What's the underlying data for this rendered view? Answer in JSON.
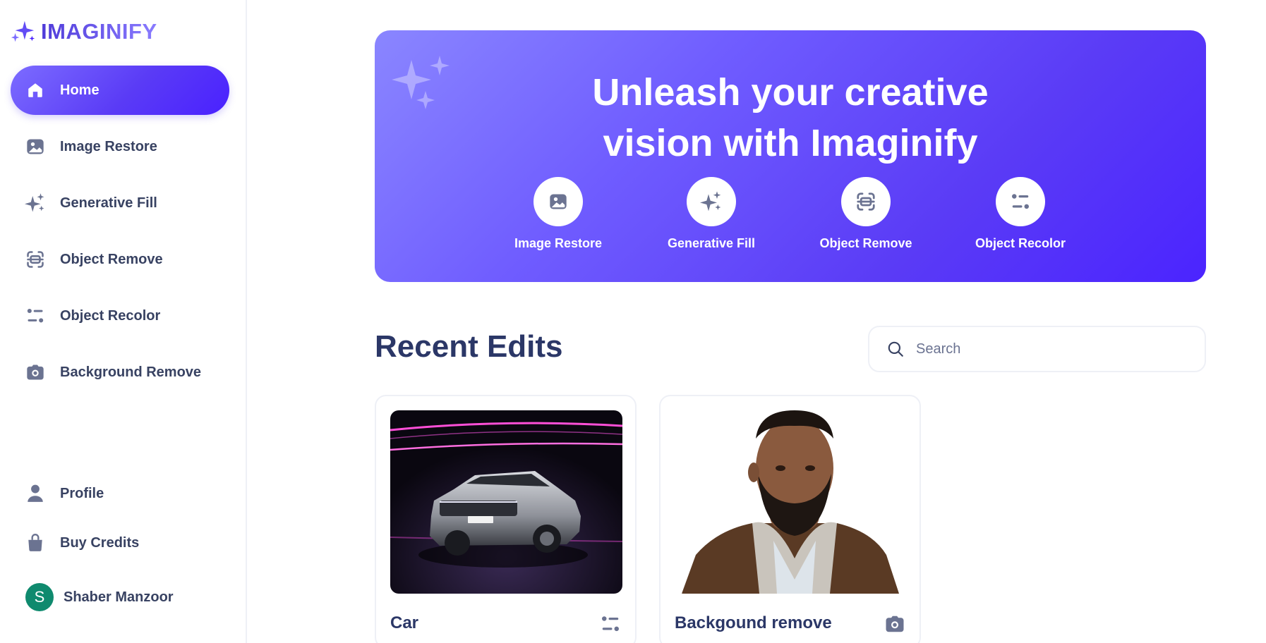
{
  "brand": {
    "name": "IMAGINIFY"
  },
  "sidebar": {
    "items": [
      {
        "label": "Home",
        "icon": "home-icon",
        "active": true
      },
      {
        "label": "Image Restore",
        "icon": "image-icon"
      },
      {
        "label": "Generative Fill",
        "icon": "sparkles-icon"
      },
      {
        "label": "Object Remove",
        "icon": "scan-icon"
      },
      {
        "label": "Object Recolor",
        "icon": "filter-icon"
      },
      {
        "label": "Background Remove",
        "icon": "camera-icon"
      }
    ],
    "bottom_items": [
      {
        "label": "Profile",
        "icon": "profile-icon"
      },
      {
        "label": "Buy Credits",
        "icon": "bag-icon"
      }
    ],
    "user": {
      "initial": "S",
      "name": "Shaber Manzoor"
    }
  },
  "banner": {
    "title_line1": "Unleash your creative",
    "title_line2": "vision with Imaginify",
    "features": [
      {
        "label": "Image Restore",
        "icon": "image-icon"
      },
      {
        "label": "Generative Fill",
        "icon": "sparkles-icon"
      },
      {
        "label": "Object Remove",
        "icon": "scan-icon"
      },
      {
        "label": "Object Recolor",
        "icon": "filter-icon"
      }
    ]
  },
  "recent": {
    "title": "Recent Edits",
    "search_placeholder": "Search",
    "cards": [
      {
        "title": "Car",
        "icon": "filter-icon",
        "image": "car-photo"
      },
      {
        "title": "Backgound remove",
        "icon": "camera-icon",
        "image": "portrait-photo"
      }
    ]
  },
  "colors": {
    "accent": "#624cf5",
    "text": "#384262",
    "heading": "#2b3767",
    "avatar": "#0f8a6e"
  }
}
